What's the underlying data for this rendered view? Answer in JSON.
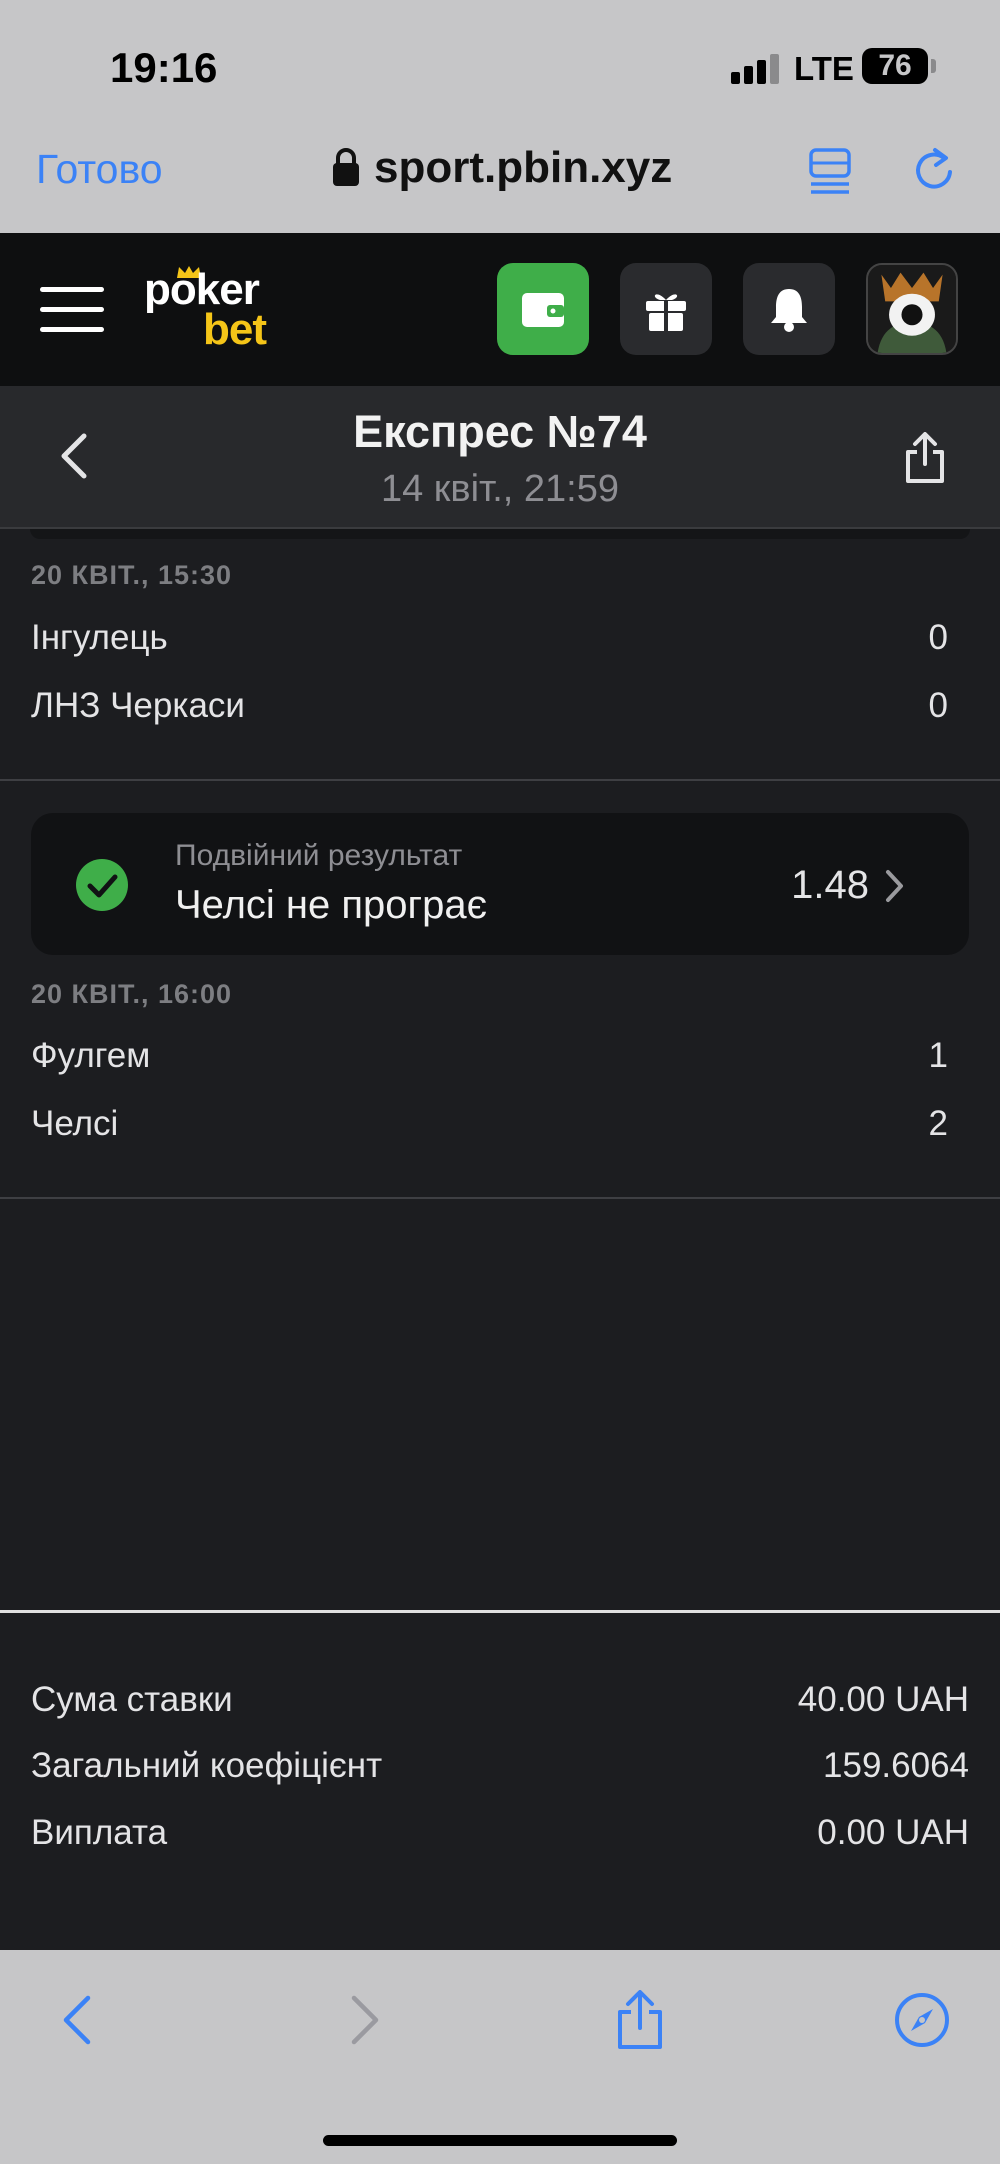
{
  "status_bar": {
    "time": "19:16",
    "network": "LTE",
    "battery": "76"
  },
  "safari": {
    "done_label": "Готово",
    "url": "sport.pbin.xyz"
  },
  "header": {
    "logo_top": "poker",
    "logo_bottom": "bet",
    "accent_color": "#3fae49",
    "logo_accent": "#f5c518"
  },
  "page": {
    "title": "Експрес №74",
    "subtitle": "14 квіт., 21:59"
  },
  "matches": [
    {
      "date": "20 КВІТ., 15:30",
      "teams": [
        {
          "name": "Інгулець",
          "score": "0"
        },
        {
          "name": "ЛНЗ Черкаси",
          "score": "0"
        }
      ]
    },
    {
      "bet": {
        "market": "Подвійний результат",
        "selection": "Челсі не програє",
        "odds": "1.48",
        "status": "won",
        "status_icon": "check-circle-icon"
      },
      "date": "20 КВІТ., 16:00",
      "teams": [
        {
          "name": "Фулгем",
          "score": "1"
        },
        {
          "name": "Челсі",
          "score": "2"
        }
      ]
    }
  ],
  "summary": {
    "stake_label": "Сума ставки",
    "stake_value": "40.00 UAH",
    "total_odds_label": "Загальний коефіцієнт",
    "total_odds_value": "159.6064",
    "payout_label": "Виплата",
    "payout_value": "0.00 UAH"
  }
}
